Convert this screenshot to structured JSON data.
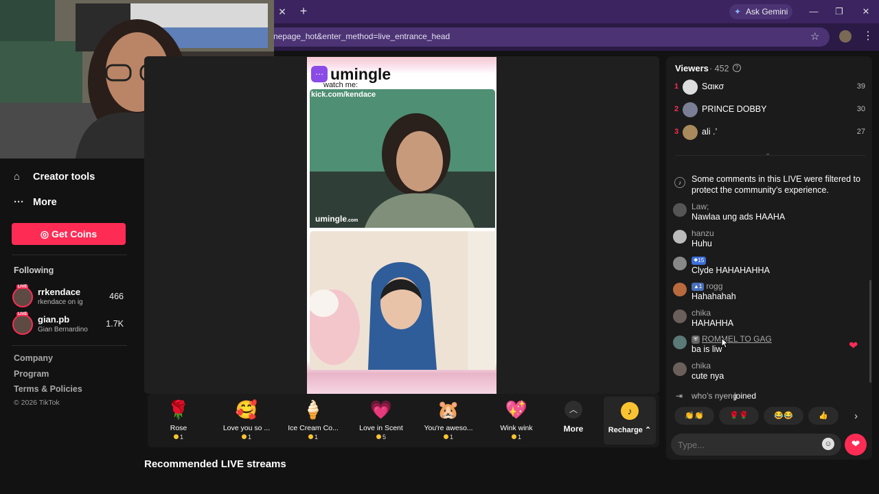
{
  "browser": {
    "url": "nepage_hot&enter_method=live_entrance_head",
    "new_tab": "+",
    "close_tab": "✕",
    "gemini_label": "Ask Gemini"
  },
  "sidebar": {
    "creator_tools": "Creator tools",
    "more": "More",
    "get_coins": "Get Coins",
    "following_heading": "Following",
    "following": [
      {
        "name": "rrkendace",
        "sub": "rkendace on ig",
        "count": "466"
      },
      {
        "name": "gian.pb",
        "sub": "Gian Bernardino",
        "count": "1.7K"
      }
    ],
    "live_badge": "LIVE",
    "footer": [
      "Company",
      "Program",
      "Terms & Policies"
    ],
    "copyright": "© 2026 TikTok"
  },
  "stream": {
    "brand": "umingle",
    "overlay_watch": "watch me:",
    "overlay_kick": "kick.com/kendace",
    "watermark": "umingle",
    "watermark_suffix": ".com"
  },
  "gifts": [
    {
      "name": "Rose",
      "price": "1",
      "icon": "rose"
    },
    {
      "name": "Love you so ...",
      "price": "1",
      "icon": "love-face"
    },
    {
      "name": "Ice Cream Co...",
      "price": "1",
      "icon": "ice-cream"
    },
    {
      "name": "Love in Scent",
      "price": "5",
      "icon": "perfume"
    },
    {
      "name": "You're aweso...",
      "price": "1",
      "icon": "hamster"
    },
    {
      "name": "Wink wink",
      "price": "1",
      "icon": "heart-wink"
    }
  ],
  "gift_more": "More",
  "recharge": "Recharge",
  "recommended_heading": "Recommended LIVE streams",
  "viewers": {
    "title": "Viewers",
    "count": "· 452",
    "list": [
      {
        "rank": "1",
        "name": "Sαικσ",
        "score": "39"
      },
      {
        "rank": "2",
        "name": "PRINCE DOBBY",
        "score": "30"
      },
      {
        "rank": "3",
        "name": "ali .’",
        "score": "27"
      }
    ]
  },
  "chat": {
    "system_message": "Some comments in this LIVE were filtered to protect the community’s experience.",
    "comments": [
      {
        "user": "Law;",
        "badge": "",
        "text": "Nawlaa ung ads HAAHA"
      },
      {
        "user": "hanzu",
        "badge": "",
        "text": "Huhu"
      },
      {
        "user": "",
        "badge": "15",
        "text": "Clyde HAHAHAHHA"
      },
      {
        "user": "rogg",
        "badge": "1",
        "text": "Hahahahah"
      },
      {
        "user": "chika",
        "badge": "",
        "text": "HAHAHHA"
      },
      {
        "user": "ROMMEL TO GAG",
        "badge": "",
        "text": "ba is liw"
      },
      {
        "user": "chika",
        "badge": "",
        "text": "cute nya"
      }
    ],
    "joined_user": "who’s nyeng",
    "joined_text": "joined",
    "quick_emojis": [
      "👏👏",
      "🌹🌹",
      "😂😂",
      "👍"
    ],
    "input_placeholder": "Type..."
  },
  "colors": {
    "accent": "#fe2c55",
    "browser_tab": "#3b2460",
    "coin": "#f8c430"
  }
}
